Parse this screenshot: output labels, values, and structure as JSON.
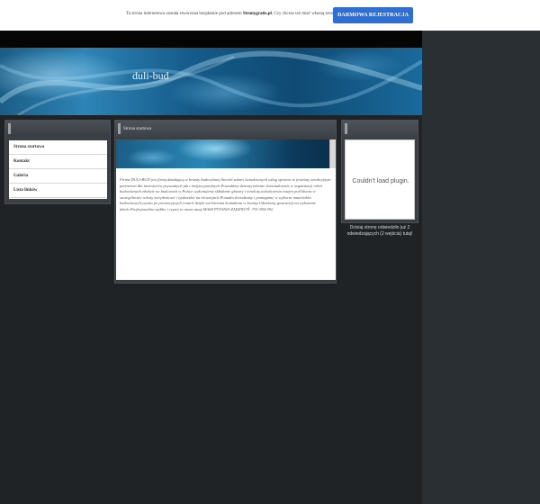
{
  "promo": {
    "text_prefix": "Ta strona internetowa została stworzona bezpłatnie pod adresem",
    "text_brand": "Stronygratis.pl",
    "text_suffix": ". Czy chcesz też mieć własną stronę?",
    "button_label": "DARMOWA REJESTRACJA"
  },
  "header": {
    "site_title": "duli-bud"
  },
  "sidebar": {
    "items": [
      {
        "label": "Strona startowa"
      },
      {
        "label": "Kontakt"
      },
      {
        "label": "Galeria"
      },
      {
        "label": "Lista linków"
      }
    ]
  },
  "content": {
    "title": "Strona startowa",
    "body": "Firma DULI-BUD jest firmą działającą w branży budowlanej.Szeroki zakres świadczonych usług sprawia iż jesteśmy atrakcyjnym partnerem dla inwestorów prywatnych jak i instytucjonalnych.Posiadamy dziesięcioletnie doświadczenie w organizacji robót budowlanych zdobyte na budowach w Polsce wykonujemy składanie glazury i terakoty,wykończenia wnętrz pod klucza w szczególności roboty ściepłeniowe i tynkarskie na elewacjach.Ponadto doradzamy i pomagamy w wyborze materiałów budowlanych,czynia po promocyjnych cenach dzięki wieloletnim kontaktom w branży.Udzielamy gwarancji na wykonane dzieło.Profesjonalnie,szybko i czysto to nasze atuty.MASZ PYTANIA ZADZWOŃ :791-994-592"
  },
  "widget": {
    "plugin_message": "Couldn't load plugin.",
    "visits_text": "Dzisiaj stronę odwiedziło już 2 odwiedzających (2 wejścia) tutaj!"
  },
  "colors": {
    "accent_button": "#2f6fd1",
    "background": "#1f2326",
    "panel": "#3a3f44"
  }
}
